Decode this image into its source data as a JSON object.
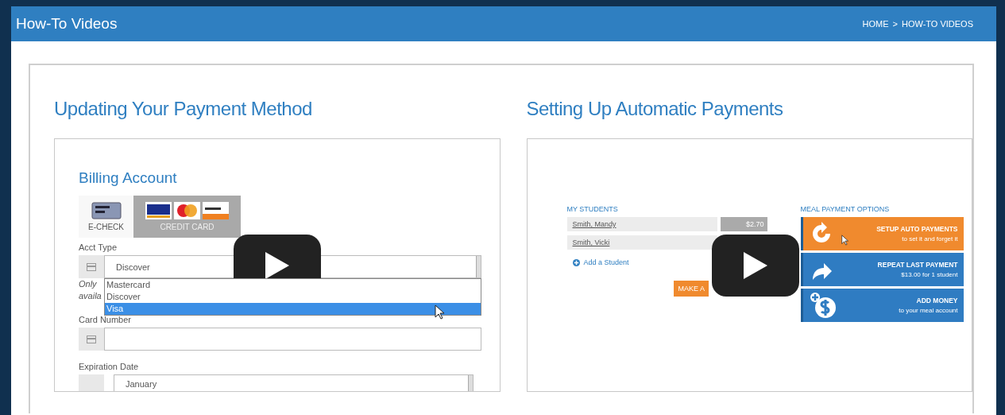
{
  "page_title": "How-To Videos",
  "breadcrumb": {
    "items": [
      "HOME",
      "HOW-TO VIDEOS"
    ],
    "separator": ">"
  },
  "videos": [
    {
      "title": "Updating Your Payment Method",
      "frame": {
        "kind": "billing",
        "heading": "Billing Account",
        "tabs": [
          {
            "label": "E-CHECK",
            "selected": false
          },
          {
            "label": "CREDIT CARD",
            "selected": true
          }
        ],
        "acct_type_label": "Acct Type",
        "acct_type_value": "Discover",
        "hint_fragments": [
          "Only",
          "availa"
        ],
        "dropdown_options": [
          {
            "label": "Mastercard",
            "selected": false
          },
          {
            "label": "Discover",
            "selected": false
          },
          {
            "label": "Visa",
            "selected": true
          }
        ],
        "card_number_label": "Card Number",
        "expiration_label": "Expiration Date",
        "expiration_month": "January"
      }
    },
    {
      "title": "Setting Up Automatic Payments",
      "frame": {
        "kind": "meal",
        "students_heading": "MY STUDENTS",
        "students": [
          {
            "name": "Smith, Mandy",
            "balance": "$2.70"
          },
          {
            "name": "Smith, Vicki"
          }
        ],
        "add_student": "Add a Student",
        "make_button": "MAKE A",
        "options_heading": "MEAL PAYMENT OPTIONS",
        "options": [
          {
            "kind": "refresh",
            "title": "SETUP AUTO PAYMENTS",
            "subtitle": "to set it and forget it",
            "color": "#f08a2e"
          },
          {
            "kind": "repeat",
            "title": "REPEAT LAST PAYMENT",
            "subtitle": "$13.00 for 1 student",
            "color": "#2f7cc2"
          },
          {
            "kind": "add",
            "title": "ADD MONEY",
            "subtitle": "to your meal account",
            "color": "#2f7cc2"
          }
        ]
      }
    }
  ]
}
